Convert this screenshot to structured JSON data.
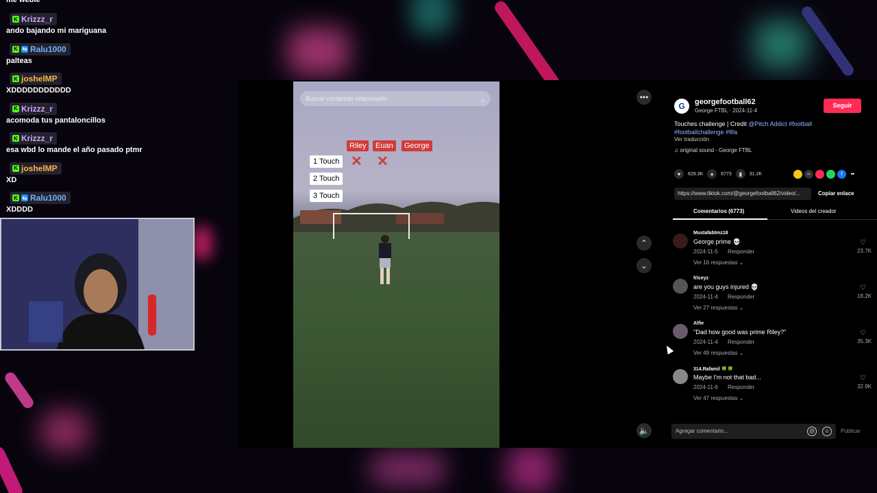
{
  "chat": [
    {
      "user": "",
      "msg": "me webie",
      "first": true
    },
    {
      "user": "Krizzz_r",
      "color": "#cfa6ff",
      "badges": [
        "k"
      ],
      "msg": "ando bajando mi mariguana"
    },
    {
      "user": "Ralu1000",
      "color": "#6fb1ff",
      "badges": [
        "k",
        "v"
      ],
      "msg": "palteas"
    },
    {
      "user": "joshelMP",
      "color": "#ffb347",
      "badges": [
        "k"
      ],
      "msg": "XDDDDDDDDDDD"
    },
    {
      "user": "Krizzz_r",
      "color": "#cfa6ff",
      "badges": [
        "k"
      ],
      "msg": "acomoda tus pantaloncillos"
    },
    {
      "user": "Krizzz_r",
      "color": "#cfa6ff",
      "badges": [
        "k"
      ],
      "msg": "esa wbd lo mande el año pasado ptmr"
    },
    {
      "user": "joshelMP",
      "color": "#ffb347",
      "badges": [
        "k"
      ],
      "msg": "XD"
    },
    {
      "user": "Ralu1000",
      "color": "#6fb1ff",
      "badges": [
        "k",
        "v"
      ],
      "msg": "XDDDD"
    }
  ],
  "video": {
    "search_placeholder": "Buscar contenido relacionado",
    "names": [
      "Riley",
      "Euan",
      "George"
    ],
    "touches": [
      "1 Touch",
      "2 Touch",
      "3 Touch"
    ]
  },
  "post": {
    "avatar_letter": "G",
    "author": "georgefootball62",
    "author_sub": "George FTBL · 2024-11-4",
    "follow_label": "Seguir",
    "desc_plain": "Touches challenge | Credit ",
    "desc_mention": "@Pitch Addict #football",
    "desc_tags": "#footballchallenge #fifa",
    "translate": "Ver traducción",
    "sound": "original sound - George FTBL",
    "likes": "629.3K",
    "comments": "6773",
    "saves": "31.2K",
    "url": "https://www.tiktok.com/@georgefootball62/video/...",
    "copy_label": "Copiar enlace",
    "tab_comments": "Comentarios (6773)",
    "tab_videos": "Videos del creador"
  },
  "comments": [
    {
      "user": "Mustafabtmz18",
      "text": "George prime 💀",
      "date": "2024-11-5",
      "reply": "Responder",
      "more": "Ver 16 respuestas ⌄",
      "likes": "23.7K"
    },
    {
      "user": "frlceyz",
      "text": "are you guys injured 💀",
      "date": "2024-11-4",
      "reply": "Responder",
      "more": "Ver 27 respuestas ⌄",
      "likes": "18.2K"
    },
    {
      "user": "Alfie",
      "text": "\"Dad how good was prime Riley?\"",
      "date": "2024-11-4",
      "reply": "Responder",
      "more": "Ver 49 respuestas ⌄",
      "likes": "35.3K"
    },
    {
      "user": "314.Rafamil 🍀🍀",
      "text": "Maybe I'm not that bad...",
      "date": "2024-11-6",
      "reply": "Responder",
      "more": "Ver 47 respuestas ⌄",
      "likes": "32.9K"
    }
  ],
  "composer": {
    "placeholder": "Agregar comentario...",
    "publish": "Publicar"
  }
}
